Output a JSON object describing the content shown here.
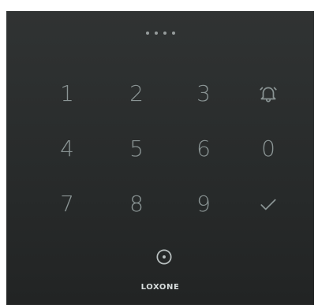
{
  "app": {
    "brand": "LOXONE"
  },
  "pin": {
    "dots_count": 4
  },
  "keys": {
    "k1": "1",
    "k2": "2",
    "k3": "3",
    "k4": "4",
    "k5": "5",
    "k6": "6",
    "k7": "7",
    "k8": "8",
    "k9": "9",
    "k0": "0"
  },
  "icons": {
    "alarm": "bell-icon",
    "confirm": "checkmark-icon",
    "reader": "target-icon"
  },
  "colors": {
    "panel_bg": "#2b2e2e",
    "key_text": "#8a9494",
    "dot": "#b9c0c0",
    "brand_text": "#d8dddd"
  }
}
